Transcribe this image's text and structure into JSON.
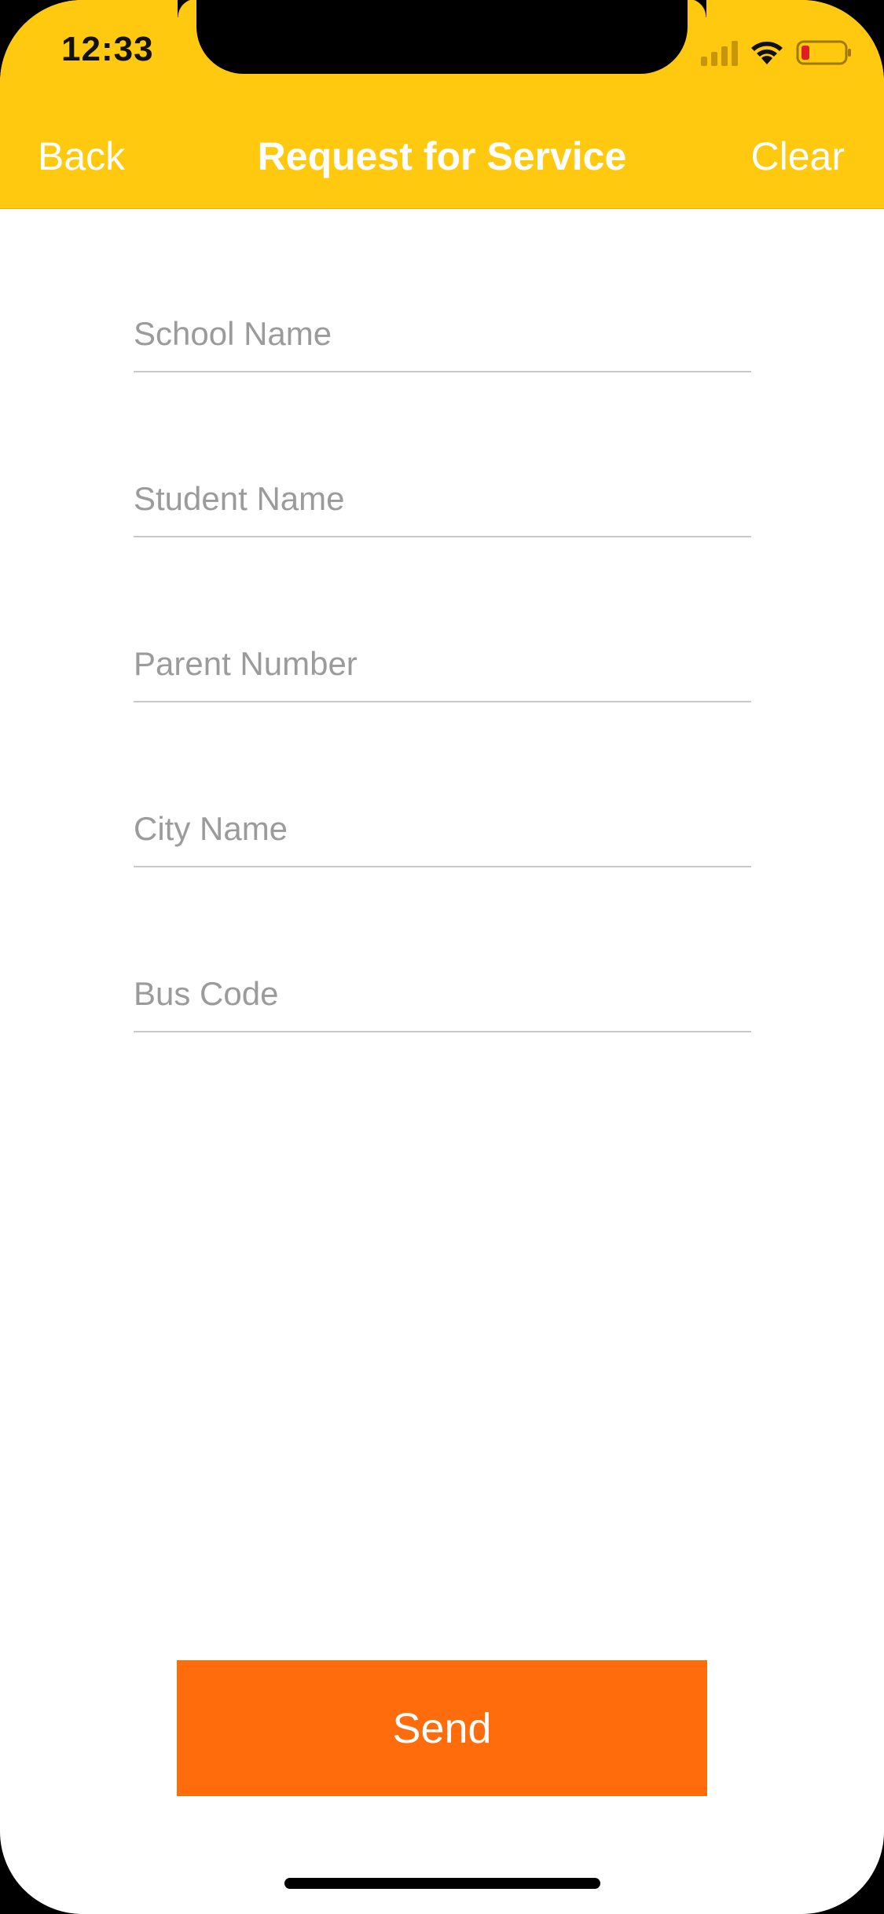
{
  "status_bar": {
    "time": "12:33",
    "icons": [
      "cellular-signal-icon",
      "wifi-icon",
      "battery-low-icon"
    ]
  },
  "nav": {
    "back_label": "Back",
    "title": "Request for Service",
    "clear_label": "Clear"
  },
  "form": {
    "fields": [
      {
        "placeholder": "School Name",
        "value": ""
      },
      {
        "placeholder": "Student Name",
        "value": ""
      },
      {
        "placeholder": "Parent Number",
        "value": ""
      },
      {
        "placeholder": "City Name",
        "value": ""
      },
      {
        "placeholder": "Bus Code",
        "value": ""
      }
    ]
  },
  "actions": {
    "send_label": "Send"
  },
  "colors": {
    "header_background": "#FFC90F",
    "send_button": "#FF6C0C",
    "header_text": "#FFFFFF",
    "placeholder_text": "#9B9B9B",
    "field_underline": "#C8C8C8",
    "battery_low": "#E02020"
  }
}
